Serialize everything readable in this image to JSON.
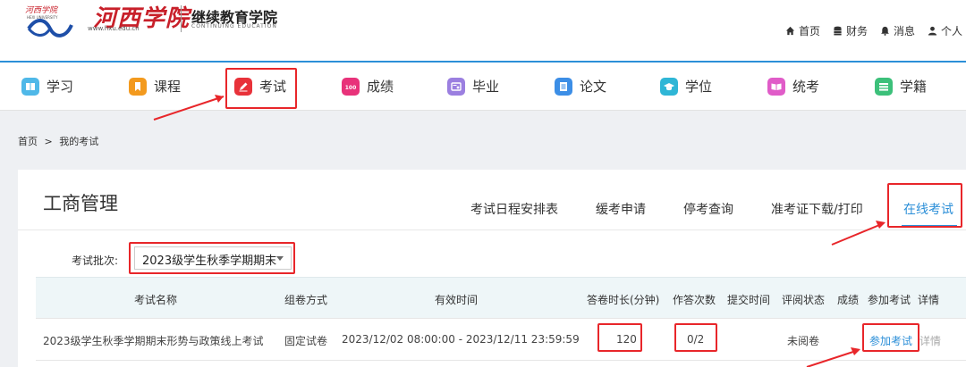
{
  "header": {
    "logo_script": "河西学院",
    "logo_url": "www.hxu.edu.cn",
    "college_name": "继续教育学院",
    "college_name_en": "CONTINUING EDUCATION",
    "links": [
      {
        "label": "首页",
        "icon": "home-icon"
      },
      {
        "label": "财务",
        "icon": "database-icon"
      },
      {
        "label": "消息",
        "icon": "bell-icon"
      },
      {
        "label": "个人",
        "icon": "user-icon"
      }
    ]
  },
  "nav": {
    "items": [
      {
        "label": "学习",
        "icon": "book-icon",
        "color": "#4fb8e8"
      },
      {
        "label": "课程",
        "icon": "bookmark-icon",
        "color": "#f39a1e"
      },
      {
        "label": "考试",
        "icon": "edit-icon",
        "color": "#e8323a"
      },
      {
        "label": "成绩",
        "icon": "score-icon",
        "color": "#e8327a"
      },
      {
        "label": "毕业",
        "icon": "certificate-icon",
        "color": "#9b7fe0"
      },
      {
        "label": "论文",
        "icon": "document-icon",
        "color": "#3c8ee6"
      },
      {
        "label": "学位",
        "icon": "graduation-cap-icon",
        "color": "#2fb6d6"
      },
      {
        "label": "统考",
        "icon": "book-open-icon",
        "color": "#e05cc8"
      },
      {
        "label": "学籍",
        "icon": "list-icon",
        "color": "#3cc07a"
      }
    ]
  },
  "breadcrumb": {
    "home": "首页",
    "separator": ">",
    "current": "我的考试"
  },
  "panel": {
    "title": "工商管理",
    "tabs": [
      "考试日程安排表",
      "缓考申请",
      "停考查询",
      "准考证下载/打印",
      "在线考试"
    ],
    "active_tab": "在线考试",
    "batch_label": "考试批次:",
    "batch_value": "2023级学生秋季学期期末"
  },
  "table": {
    "headers": [
      "考试名称",
      "组卷方式",
      "有效时间",
      "答卷时长(分钟)",
      "作答次数",
      "提交时间",
      "评阅状态",
      "成绩",
      "参加考试",
      "详情"
    ],
    "rows": [
      {
        "name": "2023级学生秋季学期期末形势与政策线上考试",
        "method": "固定试卷",
        "valid_time": "2023/12/02 08:00:00 - 2023/12/11 23:59:59",
        "duration": "120",
        "attempts": "0/2",
        "submit_time": "",
        "review_status": "未阅卷",
        "score": "",
        "action": "参加考试",
        "detail": "详情"
      }
    ]
  },
  "colors": {
    "accent": "#2c8fd8",
    "annotation": "#e8262a"
  }
}
